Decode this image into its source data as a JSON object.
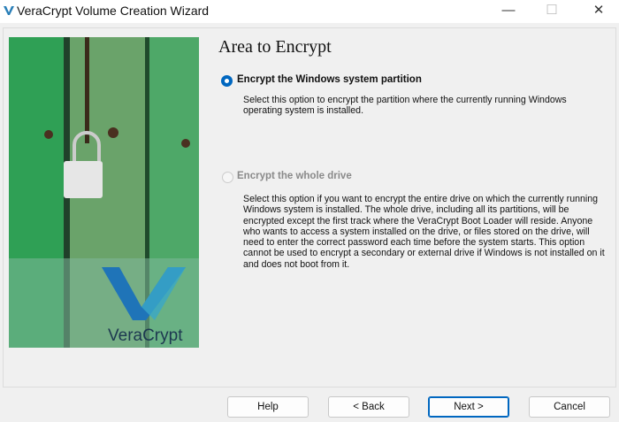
{
  "window": {
    "title": "VeraCrypt Volume Creation Wizard",
    "minimize": "—",
    "maximize": "☐",
    "close": "✕"
  },
  "page": {
    "heading": "Area to Encrypt",
    "options": [
      {
        "label": "Encrypt the Windows system partition",
        "selected": true,
        "description": "Select this option to encrypt the partition where the currently running Windows operating system is installed."
      },
      {
        "label": "Encrypt the whole drive",
        "selected": false,
        "description": "Select this option if you want to encrypt the entire drive on which the currently running Windows system is installed. The whole drive, including all its partitions, will be encrypted except the first track where the VeraCrypt Boot Loader will reside. Anyone who wants to access a system installed on the drive, or files stored on the drive, will need to enter the correct password each time before the system starts. This option cannot be used to encrypt a secondary or external drive if Windows is not installed on it and does not boot from it."
      }
    ]
  },
  "logo": {
    "text": "VeraCrypt"
  },
  "buttons": {
    "help": "Help",
    "back": "< Back",
    "next": "Next >",
    "cancel": "Cancel"
  },
  "colors": {
    "accent": "#0067c0"
  }
}
